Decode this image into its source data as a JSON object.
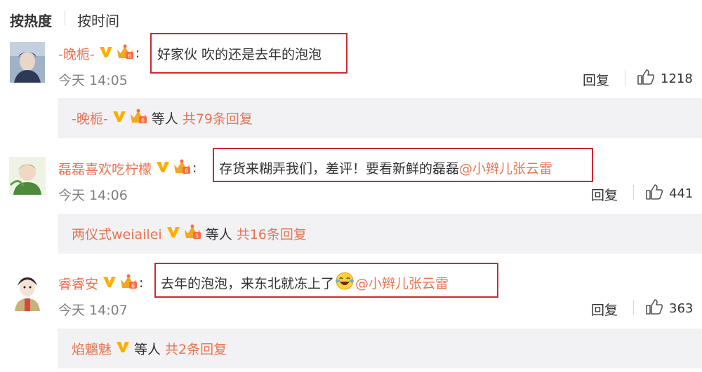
{
  "sort": {
    "hot_label": "按热度",
    "time_label": "按时间"
  },
  "comments": [
    {
      "author": "-晚栀-",
      "colon": ":",
      "text": "好家伙 吹的还是去年的泡泡",
      "mention": "",
      "emoji": "",
      "time": "今天 14:05",
      "reply_label": "回复",
      "likes": "1218",
      "sub_author": "-晚栀-",
      "sub_etc": "等人",
      "sub_total": "共79条回复"
    },
    {
      "author": "磊磊喜欢吃柠檬",
      "colon": ":",
      "text": "存货来糊弄我们，差评！要看新鲜的磊磊",
      "mention": "@小辫儿张云雷",
      "emoji": "",
      "time": "今天 14:06",
      "reply_label": "回复",
      "likes": "441",
      "sub_author": "两仪式weiailei",
      "sub_etc": "等人",
      "sub_total": "共16条回复"
    },
    {
      "author": "睿睿安",
      "colon": ":",
      "text": "去年的泡泡，来东北就冻上了",
      "mention": "@小辫儿张云雷",
      "emoji": "laughing-tears-emoji",
      "time": "今天 14:07",
      "reply_label": "回复",
      "likes": "363",
      "sub_author": "焰魑魅",
      "sub_etc": "等人",
      "sub_total": "共2条回复"
    }
  ],
  "colors": {
    "accent": "#eb7350",
    "highlight": "#d0282e",
    "panel": "#f2f2f5",
    "vip": "#ffae00"
  }
}
